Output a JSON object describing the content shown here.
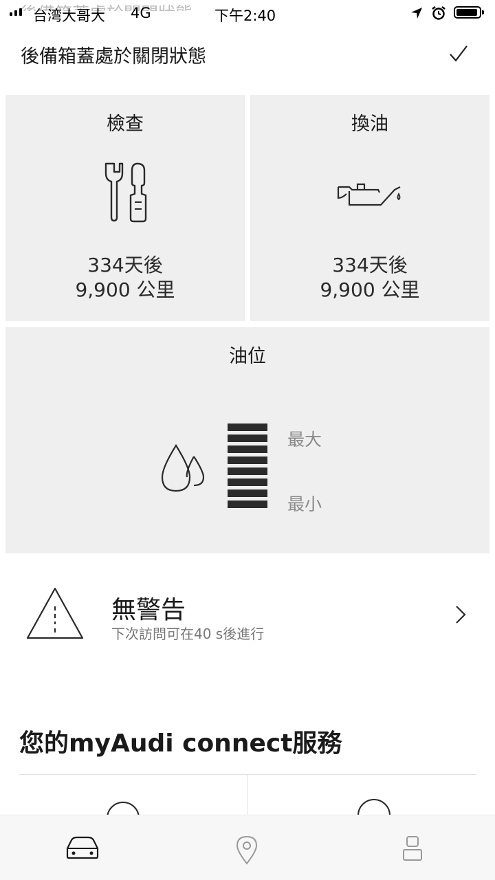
{
  "status_bar": {
    "carrier": "台湾大哥大",
    "network": "4G",
    "time": "下午2:40",
    "ghost_text": "後備箱蓋處於關閉狀態"
  },
  "notice": {
    "text": "後備箱蓋處於關閉狀態",
    "check_icon": "checkmark-icon"
  },
  "tiles": {
    "inspection": {
      "title": "檢查",
      "icon": "wrench-screwdriver-icon",
      "days": "334天後",
      "distance": "9,900 公里"
    },
    "oil_change": {
      "title": "換油",
      "icon": "oil-can-icon",
      "days": "334天後",
      "distance": "9,900 公里"
    },
    "oil_level": {
      "title": "油位",
      "icon": "oil-drops-icon",
      "max_label": "最大",
      "min_label": "最小",
      "level_segments_filled": 8,
      "level_segments_total": 8
    }
  },
  "warning": {
    "icon": "warning-triangle-icon",
    "title": "無警告",
    "subtitle": "下次訪問可在40 s後進行",
    "chevron_icon": "chevron-right-icon"
  },
  "services": {
    "title": "您的myAudi connect服務"
  },
  "tab_bar": {
    "items": [
      {
        "name": "vehicle",
        "icon": "car-icon",
        "active": true
      },
      {
        "name": "location",
        "icon": "location-pin-icon",
        "active": false
      },
      {
        "name": "profile",
        "icon": "person-icon",
        "active": false
      }
    ]
  },
  "colors": {
    "tile_background": "#efefef",
    "text_primary": "#1a1a1a",
    "text_secondary": "#8a8a8a",
    "level_bar": "#2b2b2b"
  }
}
